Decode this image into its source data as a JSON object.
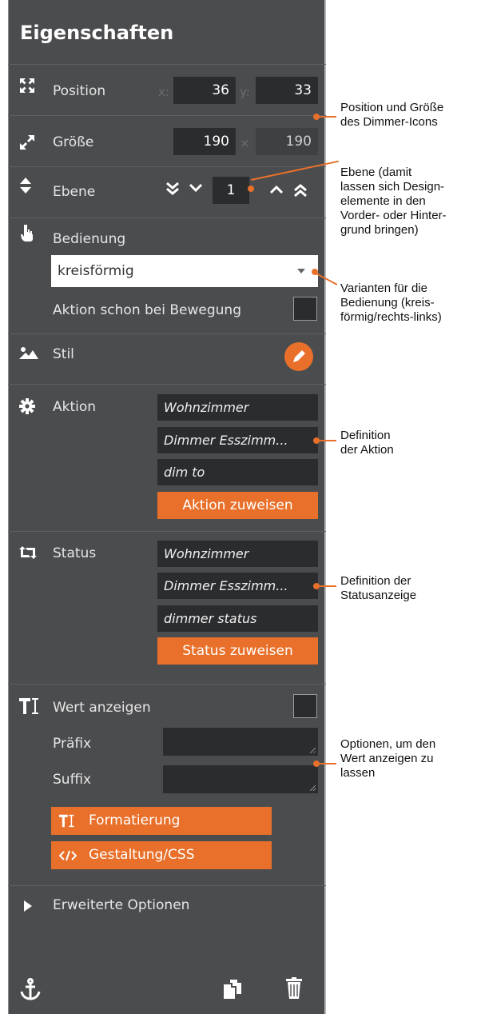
{
  "panel": {
    "title": "Eigenschaften",
    "position": {
      "label": "Position",
      "x_label": "x:",
      "x_value": "36",
      "y_label": "y:",
      "y_value": "33"
    },
    "size": {
      "label": "Größe",
      "width": "190",
      "times": "×",
      "height": "190"
    },
    "layer": {
      "label": "Ebene",
      "value": "1"
    },
    "operation": {
      "label": "Bedienung",
      "select_value": "kreisförmig",
      "checkbox_label": "Aktion schon bei Bewegung"
    },
    "style": {
      "label": "Stil"
    },
    "action": {
      "label": "Aktion",
      "fields": [
        "Wohnzimmer",
        "Dimmer Esszimm...",
        "dim to"
      ],
      "button": "Aktion zuweisen"
    },
    "status": {
      "label": "Status",
      "fields": [
        "Wohnzimmer",
        "Dimmer Esszimm...",
        "dimmer status"
      ],
      "button": "Status zuweisen"
    },
    "show_value": {
      "label": "Wert anzeigen",
      "prefix_label": "Präfix",
      "suffix_label": "Suffix",
      "format_button": "Formatierung",
      "css_button": "Gestaltung/CSS"
    },
    "advanced": {
      "label": "Erweiterte Optionen"
    }
  },
  "annotations": {
    "position": "Position und Größe\ndes Dimmer-Icons",
    "layer": "Ebene (damit\nlassen sich Design-\nelemente in den\nVorder- oder Hinter-\ngrund bringen)",
    "operation": "Varianten für die\nBedienung (kreis-\nförmig/rechts-links)",
    "action": "Definition\nder Aktion",
    "status": "Definition der\nStatusanzeige",
    "value": "Optionen, um den\nWert anzeigen zu\nlassen"
  },
  "colors": {
    "panel_bg": "#4b4c4e",
    "accent": "#e8702a",
    "field_bg": "#2b2c2e"
  }
}
